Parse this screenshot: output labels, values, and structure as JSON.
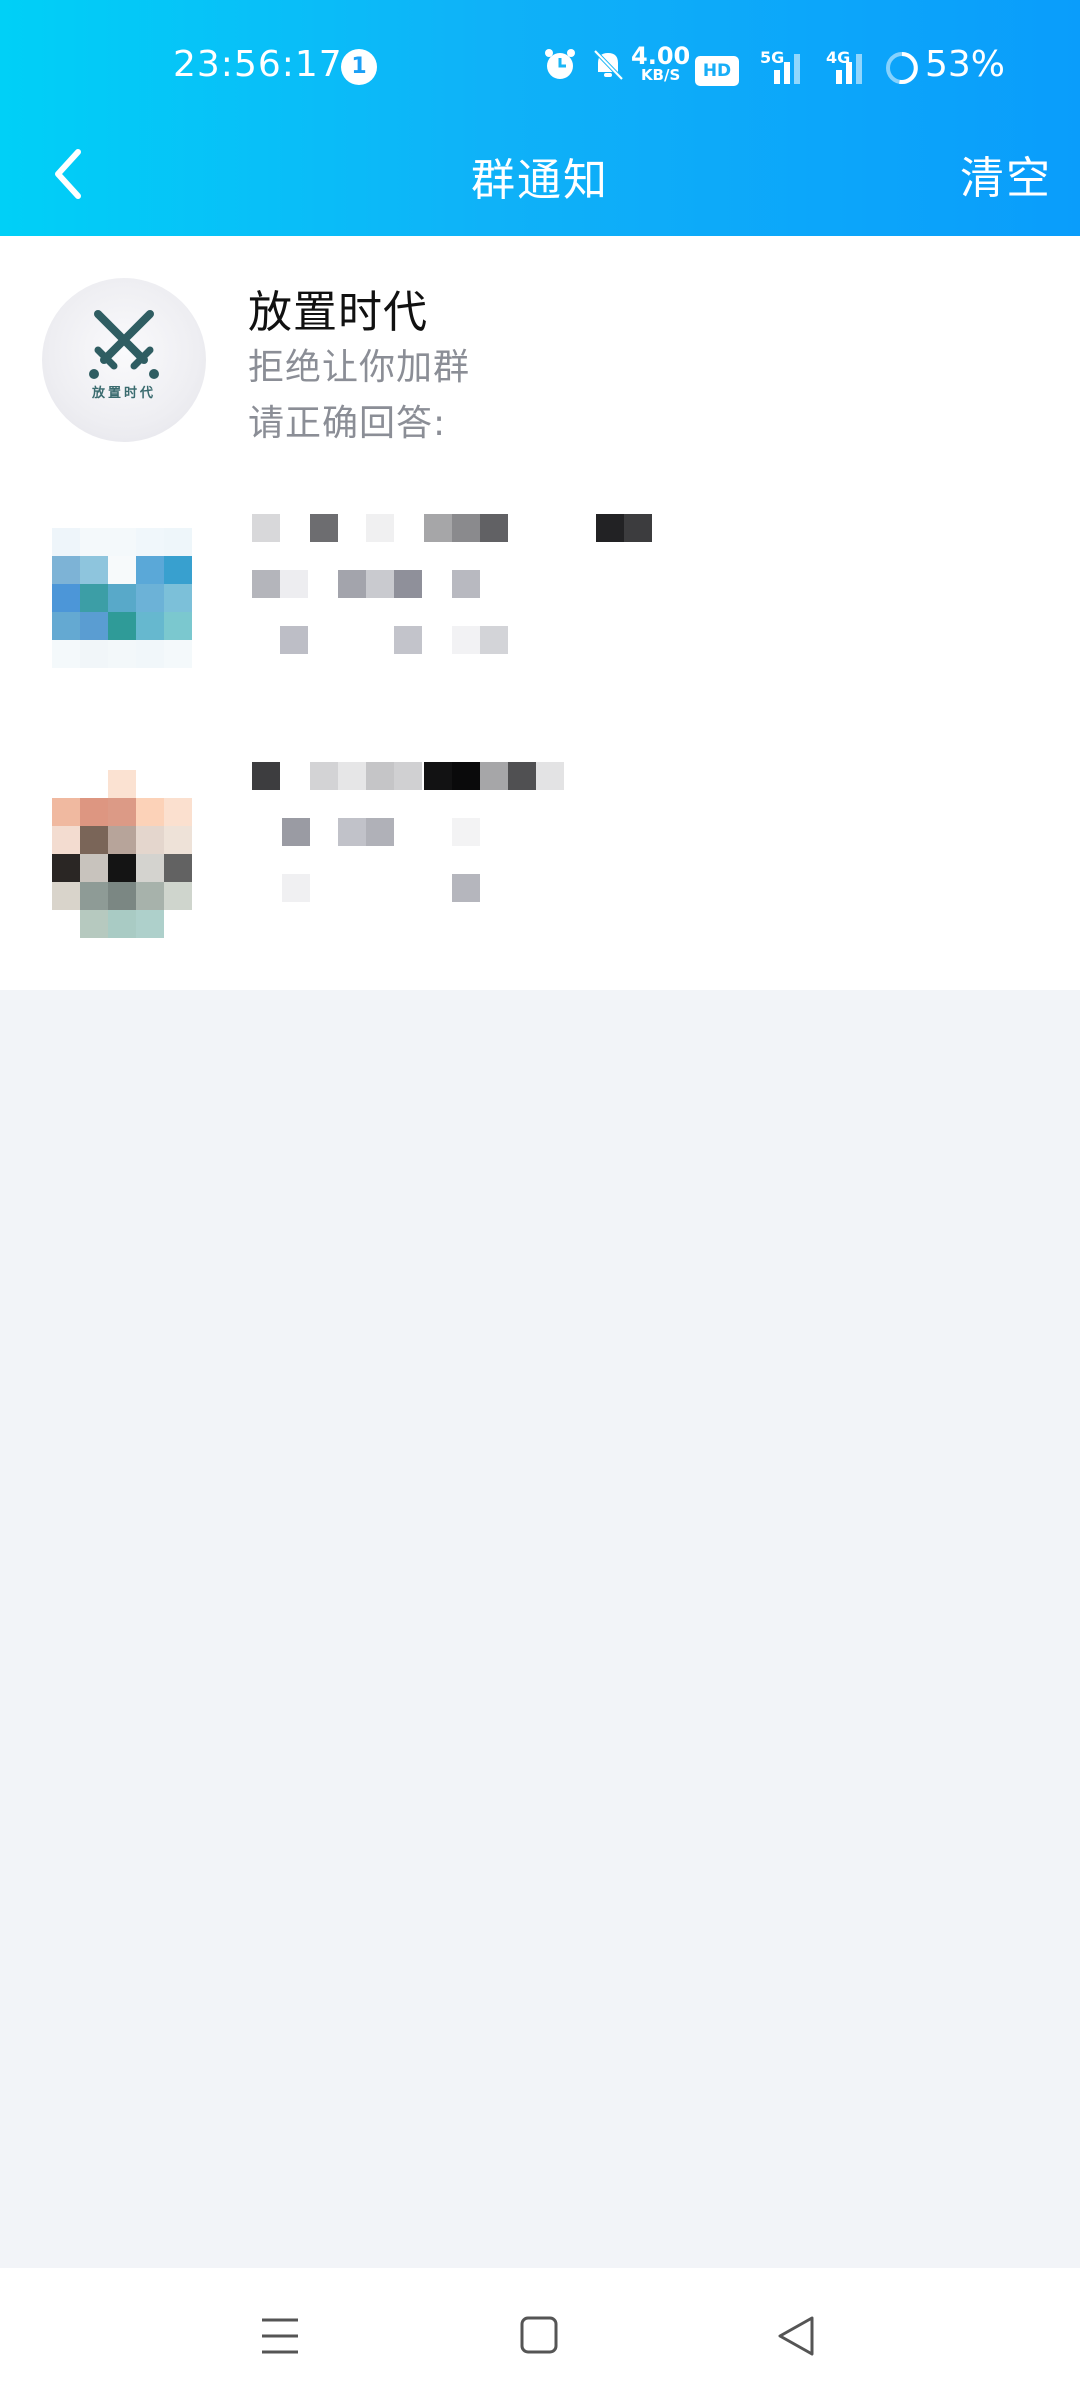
{
  "status_bar": {
    "time": "23:56:17",
    "notification_count": "1",
    "net_speed_value": "4.00",
    "net_speed_unit": "KB/S",
    "hd_label": "HD",
    "signal1_label": "5G",
    "signal2_label": "4G",
    "battery": "53%"
  },
  "header": {
    "title": "群通知",
    "clear_label": "清空"
  },
  "notifications": [
    {
      "group_name": "放置时代",
      "logo_text": "放置时代",
      "status": "拒绝让你加群",
      "answer": "请正确回答:"
    }
  ],
  "colors": {
    "header_start": "#00d0f7",
    "header_end": "#0a9dfb",
    "page_bg": "#f2f4f8"
  },
  "icons": {
    "back": "back-arrow-icon",
    "menu": "menu-icon",
    "home": "home-icon",
    "back_nav": "back-triangle-icon"
  }
}
